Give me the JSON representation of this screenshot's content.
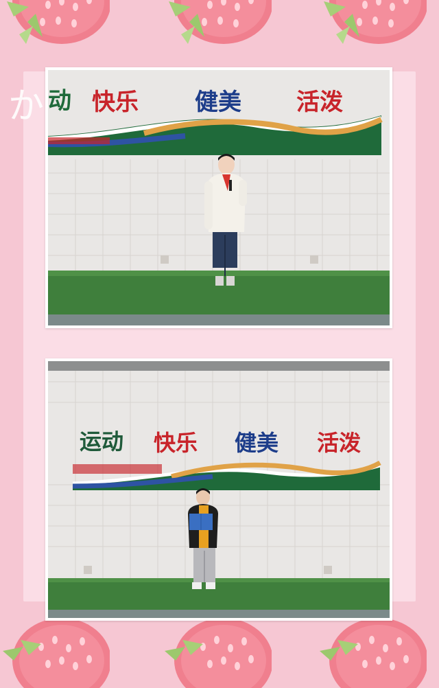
{
  "decor": {
    "overlay_text": "かい"
  },
  "photo_top": {
    "banner": {
      "word1": "动",
      "word2": "快乐",
      "word3": "健美",
      "word4": "活泼"
    }
  },
  "photo_bottom": {
    "banner": {
      "word1": "运动",
      "word2": "快乐",
      "word3": "健美",
      "word4": "活泼"
    }
  },
  "colors": {
    "background": "#f6c7d3",
    "stage_green": "#3f7f3c",
    "wall": "#e8e6e4",
    "banner_red": "#c8242a",
    "banner_blue": "#1d3d8a",
    "banner_green": "#1f6a3a"
  }
}
